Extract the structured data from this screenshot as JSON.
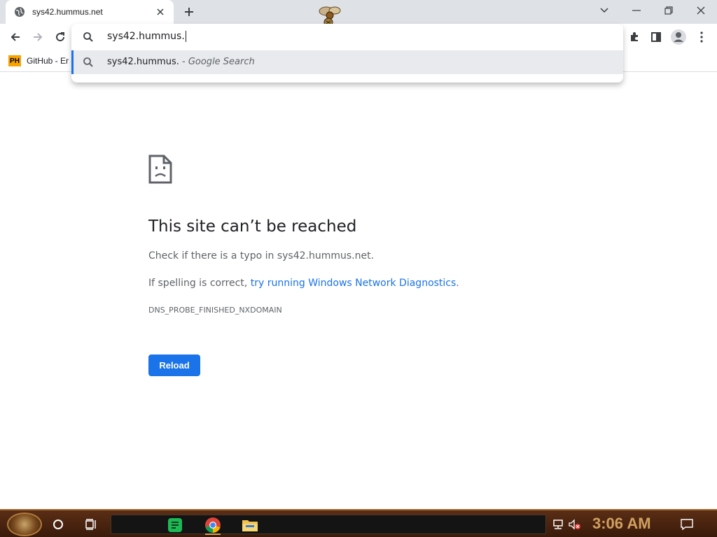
{
  "browser": {
    "tab_title": "sys42.hummus.net",
    "omnibox_text": "sys42.hummus.",
    "suggestion_text": "sys42.hummus.",
    "suggestion_suffix": " - Google Search",
    "bookmark_label": "GitHub - Er",
    "bookmark_icon_text": "PH"
  },
  "error_page": {
    "title": "This site can’t be reached",
    "line1": "Check if there is a typo in sys42.hummus.net.",
    "line2_prefix": "If spelling is correct, ",
    "line2_link": "try running Windows Network Diagnostics",
    "line2_suffix": ".",
    "error_code": "DNS_PROBE_FINISHED_NXDOMAIN",
    "reload_label": "Reload"
  },
  "taskbar": {
    "clock": "3:06 AM"
  },
  "colors": {
    "accent": "#1a73e8",
    "tabstrip": "#dee1e6",
    "taskbar": "#3a1a0a",
    "clock": "#d0a060"
  }
}
